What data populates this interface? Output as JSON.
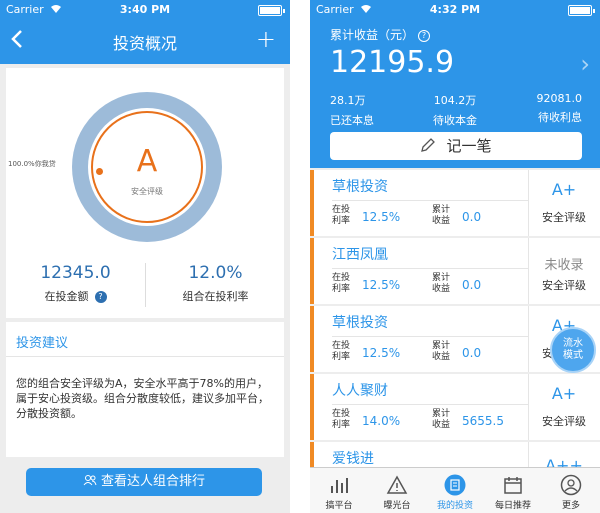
{
  "left": {
    "status": {
      "carrier": "Carrier",
      "time": "3:40 PM"
    },
    "nav": {
      "title": "投资概况"
    },
    "gauge": {
      "grade": "A",
      "grade_label": "安全评级",
      "beat_text": "100.0%你我贷"
    },
    "stats": [
      {
        "value": "12345.0",
        "label": "在投金额"
      },
      {
        "value": "12.0%",
        "label": "组合在投利率"
      }
    ],
    "advice": {
      "title": "投资建议",
      "text": "您的组合安全评级为A，安全水平高于78%的用户，属于安心投资级。组合分散度较低，建议多加平台，分散投资额。"
    },
    "rank_button": "查看达人组合排行"
  },
  "right": {
    "status": {
      "carrier": "Carrier",
      "time": "4:32 PM"
    },
    "header": {
      "subtitle": "累计收益（元）",
      "help": "?",
      "total": "12195.9",
      "stats": [
        {
          "value": "28.1万",
          "label": "已还本息"
        },
        {
          "value": "104.2万",
          "label": "待收本金"
        },
        {
          "value": "92081.0",
          "label": "待收利息"
        }
      ],
      "record_button": "记一笔"
    },
    "labels": {
      "rate_k": "在投利率",
      "earn_k": "累计收益"
    },
    "platforms": [
      {
        "name": "草根投资",
        "rate": "12.5%",
        "earnings": "0.0",
        "grade": "A+",
        "grade_label": "安全评级"
      },
      {
        "name": "江西凤凰",
        "rate": "12.5%",
        "earnings": "0.0",
        "grade": "未收录",
        "grade_label": "安全评级"
      },
      {
        "name": "草根投资",
        "rate": "12.5%",
        "earnings": "0.0",
        "grade": "A+",
        "grade_label": "安全评级"
      },
      {
        "name": "人人聚财",
        "rate": "14.0%",
        "earnings": "5655.5",
        "grade": "A+",
        "grade_label": "安全评级"
      },
      {
        "name": "爱钱进",
        "rate": "",
        "earnings": "",
        "grade": "A++",
        "grade_label": ""
      }
    ],
    "float_button": "流水模式",
    "tabs": [
      "搞平台",
      "曝光台",
      "我的投资",
      "每日推荐",
      "更多"
    ],
    "active_tab": "我的投资"
  },
  "colors": {
    "primary": "#2d95e8",
    "accent": "#e8711b",
    "ring": "#9dbbd9"
  }
}
